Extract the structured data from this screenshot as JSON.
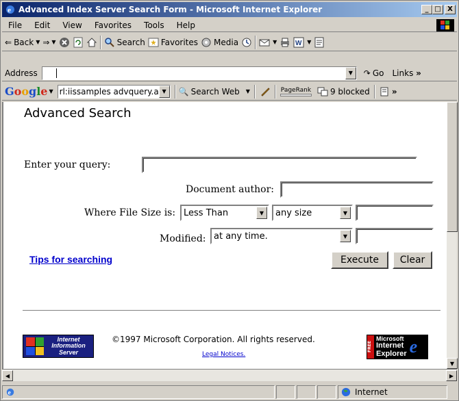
{
  "window": {
    "title": "Advanced Index Server Search Form - Microsoft Internet Explorer",
    "min": "_",
    "max": "□",
    "close": "X"
  },
  "menu": {
    "items": [
      "File",
      "Edit",
      "View",
      "Favorites",
      "Tools",
      "Help"
    ]
  },
  "toolbar": {
    "back": "Back",
    "search": "Search",
    "favorites": "Favorites",
    "media": "Media"
  },
  "address": {
    "label": "Address",
    "value": "",
    "go": "Go",
    "links": "Links"
  },
  "google": {
    "value": "rl:iissamples advquery.asp",
    "search_web": "Search Web",
    "pagerank": "PageRank",
    "blocked": "9 blocked"
  },
  "page": {
    "heading": "Advanced Search",
    "query_label": "Enter your query:",
    "query_value": "",
    "author_label": "Document author:",
    "author_value": "",
    "size_label": "Where File Size is:",
    "size_compare": "Less Than",
    "size_value": "any size",
    "size_custom": "",
    "modified_label": "Modified:",
    "modified_value": "at any time.",
    "modified_custom": "",
    "tips": "Tips for searching",
    "execute": "Execute",
    "clear": "Clear",
    "copyright": "©1997 Microsoft Corporation. All rights reserved.",
    "legal": "Legal Notices.",
    "iis_logo_text": [
      "Internet",
      "Information",
      "Server"
    ],
    "ie_logo_text": [
      "Microsoft",
      "Internet",
      "Explorer"
    ],
    "ie_logo_free": "FREE"
  },
  "status": {
    "zone": "Internet"
  }
}
